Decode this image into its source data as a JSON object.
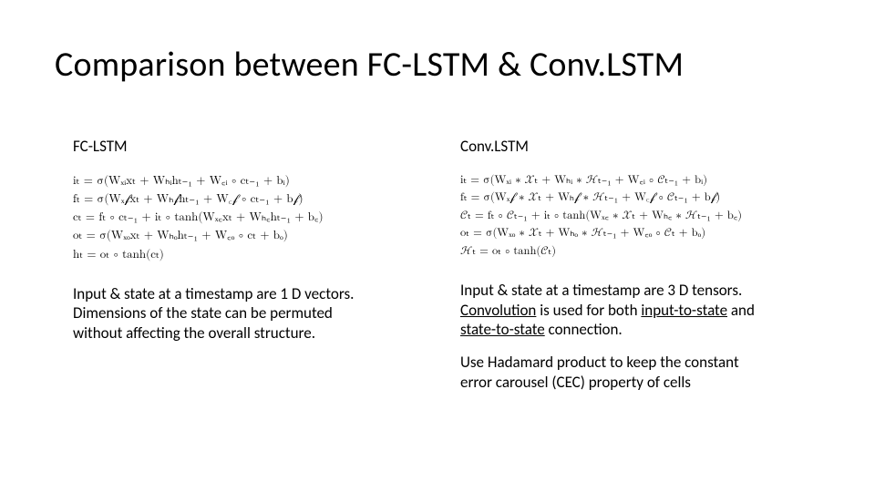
{
  "title": "Comparison between FC-LSTM & Conv.LSTM",
  "left": {
    "heading": "FC-LSTM",
    "eq_i": "iₜ = σ(Wₓᵢxₜ + Wₕᵢhₜ₋₁ + W꜀ᵢ ∘ cₜ₋₁ + bᵢ)",
    "eq_f": "fₜ = σ(Wₓ𝒻xₜ + Wₕ𝒻hₜ₋₁ + W꜀𝒻 ∘ cₜ₋₁ + b𝒻)",
    "eq_c": "cₜ = fₜ ∘ cₜ₋₁ + iₜ ∘ tanh(Wₓ꜀xₜ + Wₕ꜀hₜ₋₁ + b꜀)",
    "eq_o": "oₜ = σ(Wₓₒxₜ + Wₕₒhₜ₋₁ + W꜀ₒ ∘ cₜ + bₒ)",
    "eq_h": "hₜ = oₜ ∘ tanh(cₜ)",
    "desc": "Input & state at a timestamp are 1 D vectors. Dimensions of the state can be permuted without affecting the overall structure."
  },
  "right": {
    "heading": "Conv.LSTM",
    "eq_i": "iₜ = σ(Wₓᵢ ∗ 𝒳ₜ + Wₕᵢ ∗ ℋₜ₋₁ + W꜀ᵢ ∘ 𝒞ₜ₋₁ + bᵢ)",
    "eq_f": "fₜ = σ(Wₓ𝒻 ∗ 𝒳ₜ + Wₕ𝒻 ∗ ℋₜ₋₁ + W꜀𝒻 ∘ 𝒞ₜ₋₁ + b𝒻)",
    "eq_c": "𝒞ₜ = fₜ ∘ 𝒞ₜ₋₁ + iₜ ∘ tanh(Wₓ꜀ ∗ 𝒳ₜ + Wₕ꜀ ∗ ℋₜ₋₁ + b꜀)",
    "eq_o": "oₜ = σ(Wₓₒ ∗ 𝒳ₜ + Wₕₒ ∗ ℋₜ₋₁ + W꜀ₒ ∘ 𝒞ₜ + bₒ)",
    "eq_h": "ℋₜ = oₜ ∘ tanh(𝒞ₜ)",
    "desc1_a": "Input & state at a timestamp are 3 D tensors. ",
    "desc1_b": "Convolution",
    "desc1_c": " is used for both ",
    "desc1_d": "input-to-state",
    "desc1_e": " and ",
    "desc1_f": "state-to-state",
    "desc1_g": " connection.",
    "desc2": "Use Hadamard product to keep the constant  error carousel (CEC) property of cells"
  }
}
